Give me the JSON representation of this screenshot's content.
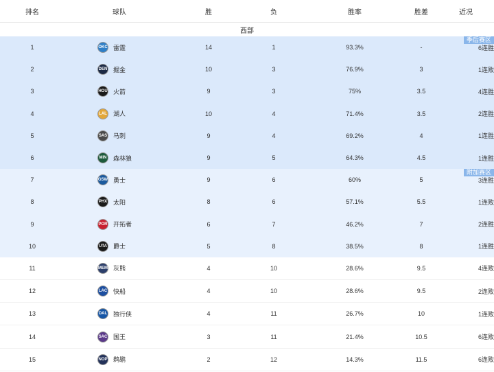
{
  "headers": {
    "rank": "排名",
    "team": "球队",
    "wins": "胜",
    "losses": "负",
    "pct": "胜率",
    "gb": "胜差",
    "streak": "近况"
  },
  "conference": "西部",
  "zones": {
    "playoff": "季后赛区",
    "playin": "附加赛区"
  },
  "rows": [
    {
      "rank": "1",
      "abbr": "OKC",
      "name": "雷霆",
      "w": "14",
      "l": "1",
      "pct": "93.3%",
      "gb": "-",
      "streak": "6连胜",
      "color": "#2f7fc7"
    },
    {
      "rank": "2",
      "abbr": "DEN",
      "name": "掘金",
      "w": "10",
      "l": "3",
      "pct": "76.9%",
      "gb": "3",
      "streak": "1连败",
      "color": "#1c2a45"
    },
    {
      "rank": "3",
      "abbr": "HOU",
      "name": "火箭",
      "w": "9",
      "l": "3",
      "pct": "75%",
      "gb": "3.5",
      "streak": "4连胜",
      "color": "#1a1a1a"
    },
    {
      "rank": "4",
      "abbr": "LAL",
      "name": "湖人",
      "w": "10",
      "l": "4",
      "pct": "71.4%",
      "gb": "3.5",
      "streak": "2连胜",
      "color": "#e2a73a"
    },
    {
      "rank": "5",
      "abbr": "SAS",
      "name": "马刺",
      "w": "9",
      "l": "4",
      "pct": "69.2%",
      "gb": "4",
      "streak": "1连胜",
      "color": "#4a4a4a"
    },
    {
      "rank": "6",
      "abbr": "MIN",
      "name": "森林狼",
      "w": "9",
      "l": "5",
      "pct": "64.3%",
      "gb": "4.5",
      "streak": "1连胜",
      "color": "#1d5a3c"
    },
    {
      "rank": "7",
      "abbr": "GSW",
      "name": "勇士",
      "w": "9",
      "l": "6",
      "pct": "60%",
      "gb": "5",
      "streak": "3连胜",
      "color": "#1c5a9e"
    },
    {
      "rank": "8",
      "abbr": "PHX",
      "name": "太阳",
      "w": "8",
      "l": "6",
      "pct": "57.1%",
      "gb": "5.5",
      "streak": "1连败",
      "color": "#1a1a1a"
    },
    {
      "rank": "9",
      "abbr": "POR",
      "name": "开拓者",
      "w": "6",
      "l": "7",
      "pct": "46.2%",
      "gb": "7",
      "streak": "2连胜",
      "color": "#c8202f"
    },
    {
      "rank": "10",
      "abbr": "UTA",
      "name": "爵士",
      "w": "5",
      "l": "8",
      "pct": "38.5%",
      "gb": "8",
      "streak": "1连胜",
      "color": "#1a1a1a"
    },
    {
      "rank": "11",
      "abbr": "MEM",
      "name": "灰熊",
      "w": "4",
      "l": "10",
      "pct": "28.6%",
      "gb": "9.5",
      "streak": "4连败",
      "color": "#2c3f6b"
    },
    {
      "rank": "12",
      "abbr": "LAC",
      "name": "快船",
      "w": "4",
      "l": "10",
      "pct": "28.6%",
      "gb": "9.5",
      "streak": "2连败",
      "color": "#1d4fa0"
    },
    {
      "rank": "13",
      "abbr": "DAL",
      "name": "独行侠",
      "w": "4",
      "l": "11",
      "pct": "26.7%",
      "gb": "10",
      "streak": "1连败",
      "color": "#1756a6"
    },
    {
      "rank": "14",
      "abbr": "SAC",
      "name": "国王",
      "w": "3",
      "l": "11",
      "pct": "21.4%",
      "gb": "10.5",
      "streak": "6连败",
      "color": "#5b3a8a"
    },
    {
      "rank": "15",
      "abbr": "NOP",
      "name": "鹈鹕",
      "w": "2",
      "l": "12",
      "pct": "14.3%",
      "gb": "11.5",
      "streak": "6连败",
      "color": "#23325a"
    }
  ]
}
